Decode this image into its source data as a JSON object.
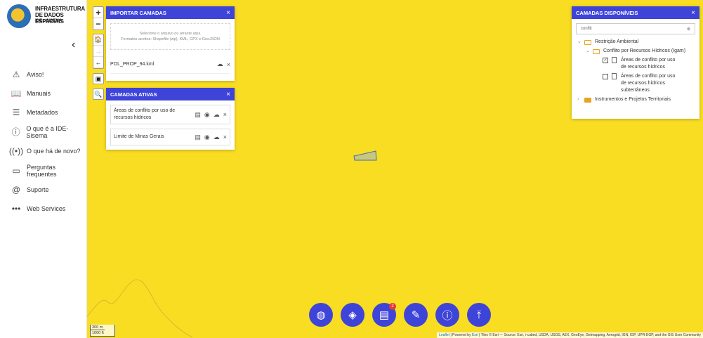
{
  "sidebar": {
    "logo_title": "INFRAESTRUTURA DE DADOS ESPACIAIS",
    "logo_subtitle": "IDE - SISEMA",
    "collapse_icon": "chevron-left-icon",
    "items": [
      {
        "label": "Aviso!",
        "icon": "warning-icon"
      },
      {
        "label": "Manuais",
        "icon": "book-icon"
      },
      {
        "label": "Metadados",
        "icon": "document-icon"
      },
      {
        "label": "O que é a IDE-Sisema",
        "icon": "info-icon"
      },
      {
        "label": "O que há de novo?",
        "icon": "broadcast-icon"
      },
      {
        "label": "Perguntas frequentes",
        "icon": "chat-icon"
      },
      {
        "label": "Suporte",
        "icon": "at-icon"
      },
      {
        "label": "Web Services",
        "icon": "dots-icon"
      }
    ]
  },
  "map_controls": {
    "zoom_in": "+",
    "zoom_out": "−"
  },
  "import_panel": {
    "title": "IMPORTAR CAMADAS",
    "dropzone_line1": "Selecione o arquivo ou arraste aqui.",
    "dropzone_line2": "Formatos aceitos: Shapefile (zip), KML, GPX e GeoJSON",
    "file_name": "POL_PROP_94.kml"
  },
  "active_panel": {
    "title": "CAMADAS ATIVAS",
    "layers": [
      {
        "label": "Áreas de conflito por uso de recursos hídricos"
      },
      {
        "label": "Limite de Minas Gerais"
      }
    ]
  },
  "available_panel": {
    "title": "CAMADAS DISPONÍVEIS",
    "search_value": "conflit",
    "tree": {
      "root1": "Restrição Ambiental",
      "child1": "Conflito por Recursos Hídricos (Igam)",
      "leaf1": "Áreas de conflito por uso de recursos hídricos",
      "leaf2": "Áreas de conflito por uso de recursos hídricos subterrâneos",
      "root2": "Instrumentos e Projetos Territoriais"
    }
  },
  "fab_buttons": [
    {
      "name": "globe",
      "icon": "globe-icon"
    },
    {
      "name": "layers",
      "icon": "layers-icon"
    },
    {
      "name": "legend",
      "icon": "list-icon",
      "badge": "2"
    },
    {
      "name": "draw",
      "icon": "pin-edit-icon"
    },
    {
      "name": "info",
      "icon": "alert-icon"
    },
    {
      "name": "upload",
      "icon": "upload-icon"
    }
  ],
  "scale": {
    "metric": "300 m",
    "imperial": "1000 ft"
  },
  "attribution": {
    "leaflet": "Leaflet",
    "powered": " | Powered by ",
    "esri": "Esri",
    "rest": " | Tiles © Esri — Source: Esri, i-cubed, USDA, USGS, AEX, GeoEye, Getmapping, Aerogrid, IGN, IGP, UPR-EGP, and the GIS User Community"
  },
  "colors": {
    "accent": "#3f44d8",
    "map": "#f9dd23",
    "badge": "#e53935"
  }
}
